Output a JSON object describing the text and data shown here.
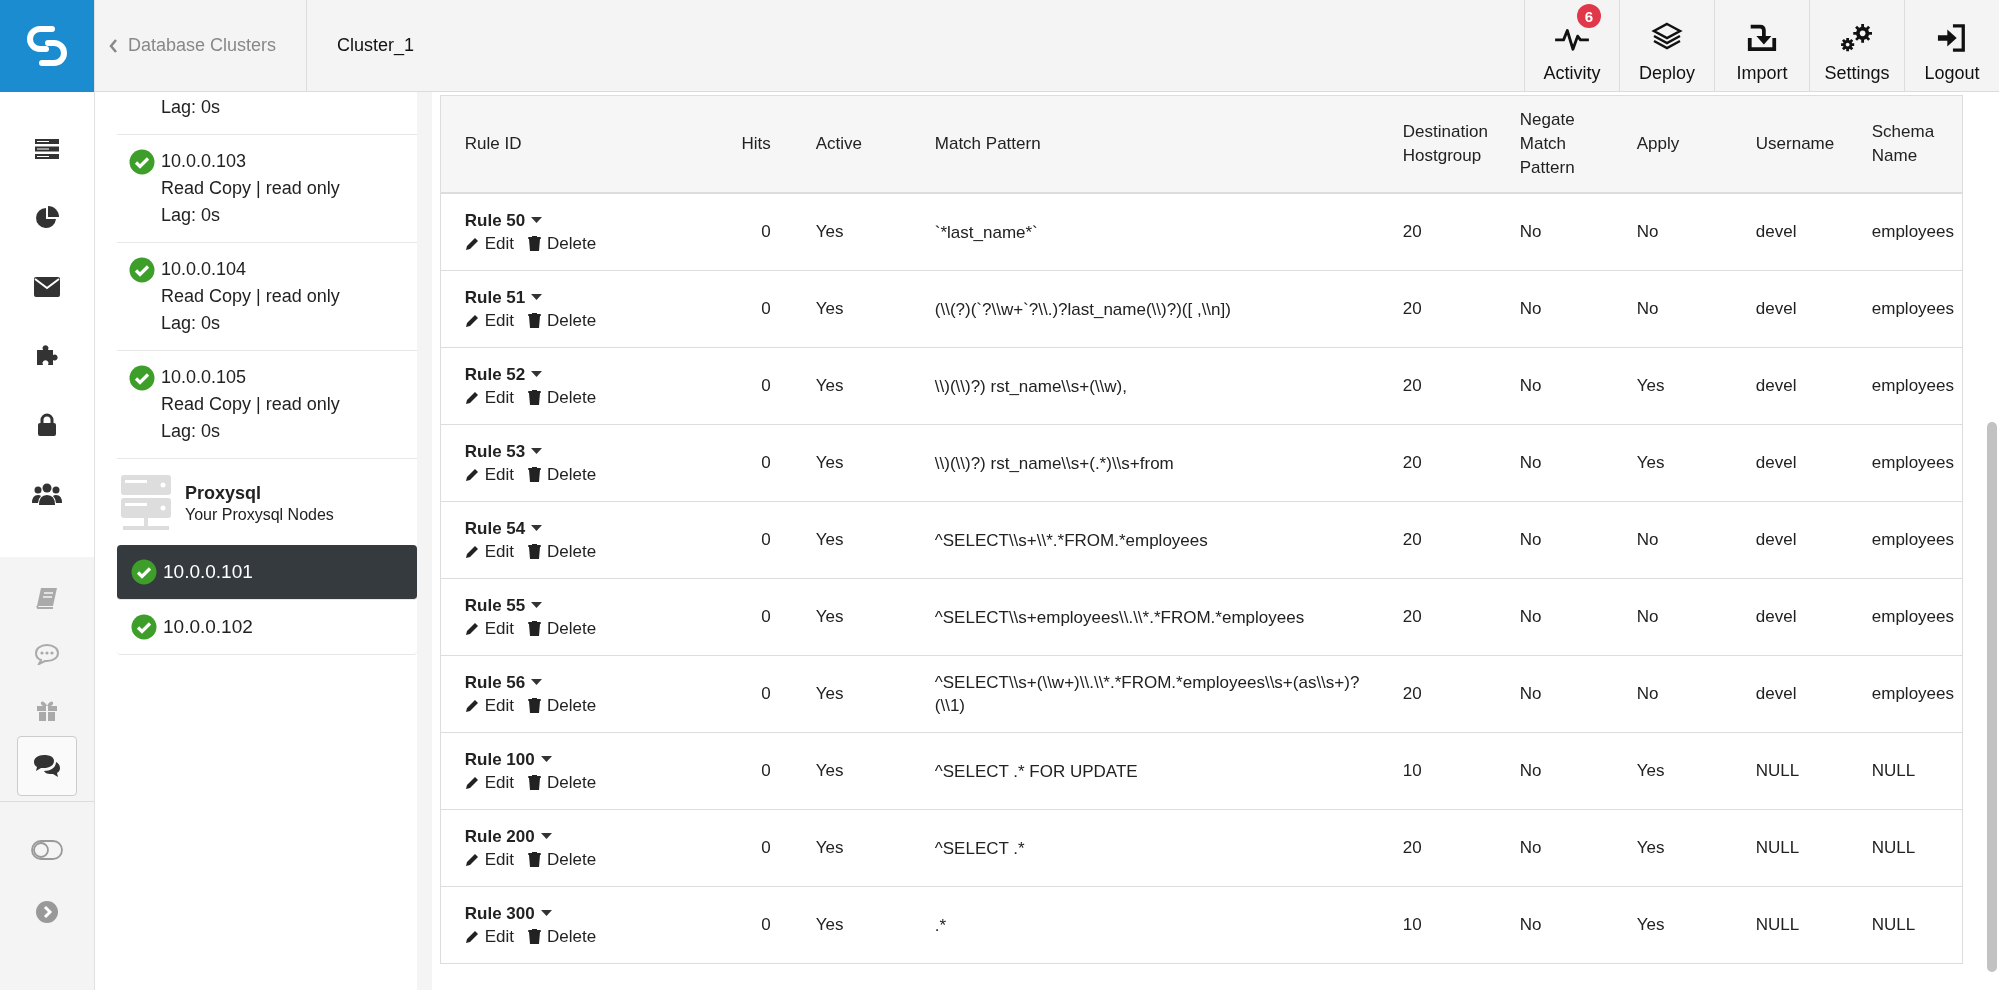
{
  "header": {
    "back_link": "Database Clusters",
    "cluster": "Cluster_1",
    "actions": [
      {
        "kind": "activity",
        "label": "Activity",
        "badge": "6"
      },
      {
        "kind": "deploy",
        "label": "Deploy"
      },
      {
        "kind": "import",
        "label": "Import"
      },
      {
        "kind": "settings",
        "label": "Settings"
      },
      {
        "kind": "logout",
        "label": "Logout"
      }
    ]
  },
  "rail": {
    "items": [
      {
        "kind": "servers",
        "selected": false
      },
      {
        "kind": "pie",
        "selected": false
      },
      {
        "kind": "mail",
        "selected": false
      },
      {
        "kind": "puzzle",
        "selected": false
      },
      {
        "kind": "lock",
        "selected": false
      },
      {
        "kind": "users",
        "selected": false
      }
    ],
    "secondary": [
      {
        "kind": "book",
        "selected": false
      },
      {
        "kind": "speech",
        "selected": false
      },
      {
        "kind": "gift",
        "selected": false
      },
      {
        "kind": "chats",
        "selected": true
      }
    ],
    "footer": [
      {
        "kind": "toggle"
      },
      {
        "kind": "chevron"
      }
    ]
  },
  "sidebar": {
    "nodes": [
      {
        "lines": [
          "Lag: 0s"
        ]
      },
      {
        "ip": "10.0.0.103",
        "healthy": true,
        "lines": [
          "Read Copy | read only",
          "Lag: 0s"
        ]
      },
      {
        "ip": "10.0.0.104",
        "healthy": true,
        "lines": [
          "Read Copy | read only",
          "Lag: 0s"
        ]
      },
      {
        "ip": "10.0.0.105",
        "healthy": true,
        "lines": [
          "Read Copy | read only",
          "Lag: 0s"
        ]
      }
    ],
    "group": {
      "title": "Proxysql",
      "subtitle": "Your Proxysql Nodes"
    },
    "proxies": [
      {
        "ip": "10.0.0.101",
        "healthy": true,
        "selected": true
      },
      {
        "ip": "10.0.0.102",
        "healthy": true,
        "selected": false
      }
    ]
  },
  "table": {
    "columns": [
      "Rule ID",
      "Hits",
      "Active",
      "Match Pattern",
      "Destination Hostgroup",
      "Negate Match Pattern",
      "Apply",
      "Username",
      "Schema Name"
    ],
    "rows": [
      {
        "rule": "Rule 50",
        "hits": "0",
        "active": "Yes",
        "pattern": "`*last_name*`",
        "dest": "20",
        "negate": "No",
        "apply": "No",
        "username": "devel",
        "schema": "employees",
        "actions": [
          {
            "kind": "edit",
            "label": "Edit"
          },
          {
            "kind": "delete",
            "label": "Delete"
          }
        ]
      },
      {
        "rule": "Rule 51",
        "hits": "0",
        "active": "Yes",
        "pattern": "(\\\\(?)(`?\\\\w+`?\\\\.)?last_name(\\\\)?)([ ,\\\\n])",
        "dest": "20",
        "negate": "No",
        "apply": "No",
        "username": "devel",
        "schema": "employees",
        "actions": [
          {
            "kind": "edit",
            "label": "Edit"
          },
          {
            "kind": "delete",
            "label": "Delete"
          }
        ]
      },
      {
        "rule": "Rule 52",
        "hits": "0",
        "active": "Yes",
        "pattern": "\\\\)(\\\\)?) rst_name\\\\s+(\\\\w),",
        "dest": "20",
        "negate": "No",
        "apply": "Yes",
        "username": "devel",
        "schema": "employees",
        "actions": [
          {
            "kind": "edit",
            "label": "Edit"
          },
          {
            "kind": "delete",
            "label": "Delete"
          }
        ]
      },
      {
        "rule": "Rule 53",
        "hits": "0",
        "active": "Yes",
        "pattern": "\\\\)(\\\\)?) rst_name\\\\s+(.*)\\\\s+from",
        "dest": "20",
        "negate": "No",
        "apply": "Yes",
        "username": "devel",
        "schema": "employees",
        "actions": [
          {
            "kind": "edit",
            "label": "Edit"
          },
          {
            "kind": "delete",
            "label": "Delete"
          }
        ]
      },
      {
        "rule": "Rule 54",
        "hits": "0",
        "active": "Yes",
        "pattern": "^SELECT\\\\s+\\\\*.*FROM.*employees",
        "dest": "20",
        "negate": "No",
        "apply": "No",
        "username": "devel",
        "schema": "employees",
        "actions": [
          {
            "kind": "edit",
            "label": "Edit"
          },
          {
            "kind": "delete",
            "label": "Delete"
          }
        ]
      },
      {
        "rule": "Rule 55",
        "hits": "0",
        "active": "Yes",
        "pattern": "^SELECT\\\\s+employees\\\\.\\\\*.*FROM.*employees",
        "dest": "20",
        "negate": "No",
        "apply": "No",
        "username": "devel",
        "schema": "employees",
        "actions": [
          {
            "kind": "edit",
            "label": "Edit"
          },
          {
            "kind": "delete",
            "label": "Delete"
          }
        ]
      },
      {
        "rule": "Rule 56",
        "hits": "0",
        "active": "Yes",
        "pattern": "^SELECT\\\\s+(\\\\w+)\\\\.\\\\*.*FROM.*employees\\\\s+(as\\\\s+)?(\\\\1)",
        "dest": "20",
        "negate": "No",
        "apply": "No",
        "username": "devel",
        "schema": "employees",
        "actions": [
          {
            "kind": "edit",
            "label": "Edit"
          },
          {
            "kind": "delete",
            "label": "Delete"
          }
        ]
      },
      {
        "rule": "Rule 100",
        "hits": "0",
        "active": "Yes",
        "pattern": "^SELECT .* FOR UPDATE",
        "dest": "10",
        "negate": "No",
        "apply": "Yes",
        "username": "NULL",
        "schema": "NULL",
        "actions": [
          {
            "kind": "edit",
            "label": "Edit"
          },
          {
            "kind": "delete",
            "label": "Delete"
          }
        ]
      },
      {
        "rule": "Rule 200",
        "hits": "0",
        "active": "Yes",
        "pattern": "^SELECT .*",
        "dest": "20",
        "negate": "No",
        "apply": "Yes",
        "username": "NULL",
        "schema": "NULL",
        "actions": [
          {
            "kind": "edit",
            "label": "Edit"
          },
          {
            "kind": "delete",
            "label": "Delete"
          }
        ]
      },
      {
        "rule": "Rule 300",
        "hits": "0",
        "active": "Yes",
        "pattern": ".*",
        "dest": "10",
        "negate": "No",
        "apply": "Yes",
        "username": "NULL",
        "schema": "NULL",
        "actions": [
          {
            "kind": "edit",
            "label": "Edit"
          },
          {
            "kind": "delete",
            "label": "Delete"
          }
        ]
      }
    ]
  }
}
